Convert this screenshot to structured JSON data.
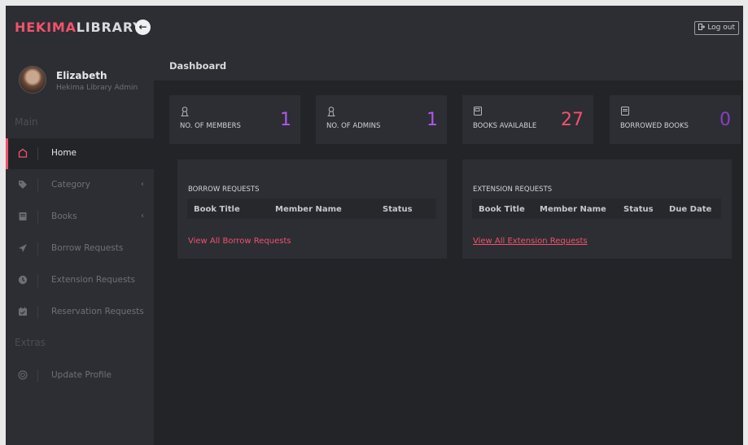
{
  "brand": {
    "accent": "HEKIMA",
    "rest": "LIBRARY"
  },
  "topbar": {
    "toggle_icon": "←",
    "logout_label": "Log out"
  },
  "profile": {
    "name": "Elizabeth",
    "role": "Hekima Library Admin"
  },
  "sidebar": {
    "main_title": "Main",
    "extras_title": "Extras",
    "items": [
      {
        "label": "Home",
        "icon": "home-icon",
        "active": true
      },
      {
        "label": "Category",
        "icon": "tag-icon",
        "chevron": "‹"
      },
      {
        "label": "Books",
        "icon": "book-icon",
        "chevron": "‹"
      },
      {
        "label": "Borrow Requests",
        "icon": "paper-plane-icon"
      },
      {
        "label": "Extension Requests",
        "icon": "clock-icon"
      },
      {
        "label": "Reservation Requests",
        "icon": "calendar-check-icon"
      }
    ],
    "extras_items": [
      {
        "label": "Update Profile",
        "icon": "settings-icon"
      }
    ]
  },
  "page": {
    "title": "Dashboard"
  },
  "stats": [
    {
      "label": "NO. OF MEMBERS",
      "value": "1",
      "icon": "user-icon",
      "color": "#b455f0"
    },
    {
      "label": "NO. OF ADMINS",
      "value": "1",
      "icon": "user-icon",
      "color": "#b455f0"
    },
    {
      "label": "BOOKS AVAILABLE",
      "value": "27",
      "icon": "book-icon",
      "color": "#f2526b"
    },
    {
      "label": "BORROWED BOOKS",
      "value": "0",
      "icon": "book-icon",
      "color": "#8a3ec2"
    }
  ],
  "borrow_panel": {
    "title": "BORROW REQUESTS",
    "columns": [
      "Book Title",
      "Member Name",
      "Status"
    ],
    "link": "View All Borrow Requests"
  },
  "extension_panel": {
    "title": "EXTENSION REQUESTS",
    "columns": [
      "Book Title",
      "Member Name",
      "Status",
      "Due Date"
    ],
    "link": "View All Extension Requests"
  },
  "colors": {
    "accent": "#f2526b",
    "background": "#222428",
    "panel": "#2c2e33"
  }
}
